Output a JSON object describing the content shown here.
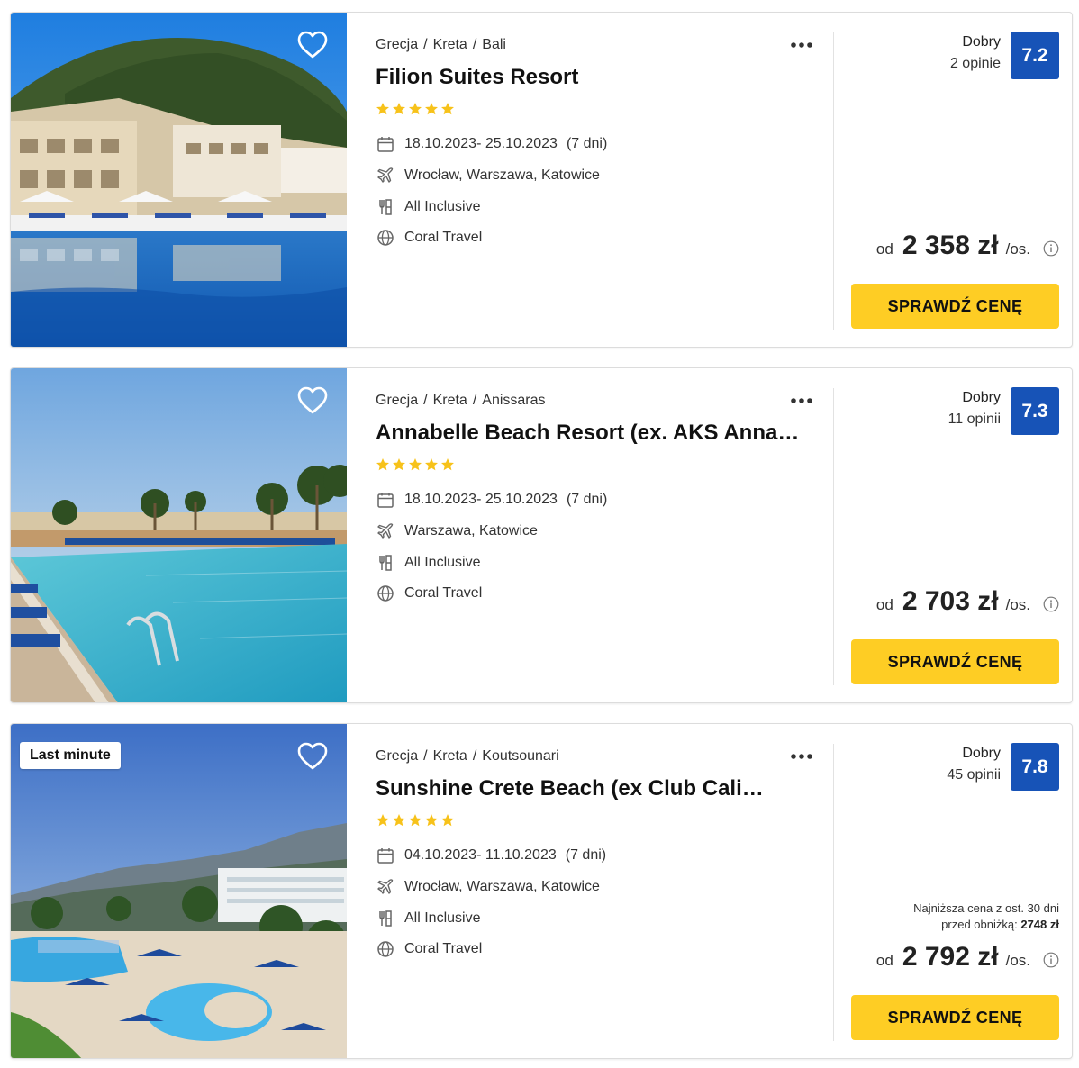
{
  "icons": {
    "favorite": "heart-icon",
    "more": "more-dots-icon",
    "star": "star-icon",
    "date": "calendar-icon",
    "departure": "plane-icon",
    "board": "cutlery-icon",
    "operator": "globe-icon",
    "info": "info-icon"
  },
  "colors": {
    "score_bg": "#1753b7",
    "cta_bg": "#fecd24",
    "star": "#f7c21a"
  },
  "offers": [
    {
      "badge": "",
      "breadcrumb": [
        "Grecja",
        "Kreta",
        "Bali"
      ],
      "breadcrumb_sep": "/",
      "name": "Filion Suites Resort",
      "stars": 5,
      "dates": "18.10.2023- 25.10.2023",
      "duration": "(7 dni)",
      "departure": "Wrocław, Warszawa, Katowice",
      "board": "All Inclusive",
      "operator": "Coral Travel",
      "rating_label": "Dobry",
      "rating_count": "2 opinie",
      "score": "7.2",
      "lowest_price_line1": "",
      "lowest_price_line2": "",
      "lowest_price_value": "",
      "price_prefix": "od",
      "price": "2 358 zł",
      "price_unit": "/os.",
      "cta": "SPRAWDŹ CENĘ"
    },
    {
      "badge": "",
      "breadcrumb": [
        "Grecja",
        "Kreta",
        "Anissaras"
      ],
      "breadcrumb_sep": "/",
      "name": "Annabelle Beach Resort (ex. AKS Annabelle Village)",
      "stars": 5,
      "dates": "18.10.2023- 25.10.2023",
      "duration": "(7 dni)",
      "departure": "Warszawa, Katowice",
      "board": "All Inclusive",
      "operator": "Coral Travel",
      "rating_label": "Dobry",
      "rating_count": "11 opinii",
      "score": "7.3",
      "lowest_price_line1": "",
      "lowest_price_line2": "",
      "lowest_price_value": "",
      "price_prefix": "od",
      "price": "2 703 zł",
      "price_unit": "/os.",
      "cta": "SPRAWDŹ CENĘ"
    },
    {
      "badge": "Last minute",
      "breadcrumb": [
        "Grecja",
        "Kreta",
        "Koutsounari"
      ],
      "breadcrumb_sep": "/",
      "name": "Sunshine Crete Beach (ex Club Calimera Sunshine Crete)",
      "stars": 5,
      "dates": "04.10.2023- 11.10.2023",
      "duration": "(7 dni)",
      "departure": "Wrocław, Warszawa, Katowice",
      "board": "All Inclusive",
      "operator": "Coral Travel",
      "rating_label": "Dobry",
      "rating_count": "45 opinii",
      "score": "7.8",
      "lowest_price_line1": "Najniższa cena z ost. 30 dni",
      "lowest_price_line2": "przed obniżką:",
      "lowest_price_value": "2748 zł",
      "price_prefix": "od",
      "price": "2 792 zł",
      "price_unit": "/os.",
      "cta": "SPRAWDŹ CENĘ"
    }
  ]
}
